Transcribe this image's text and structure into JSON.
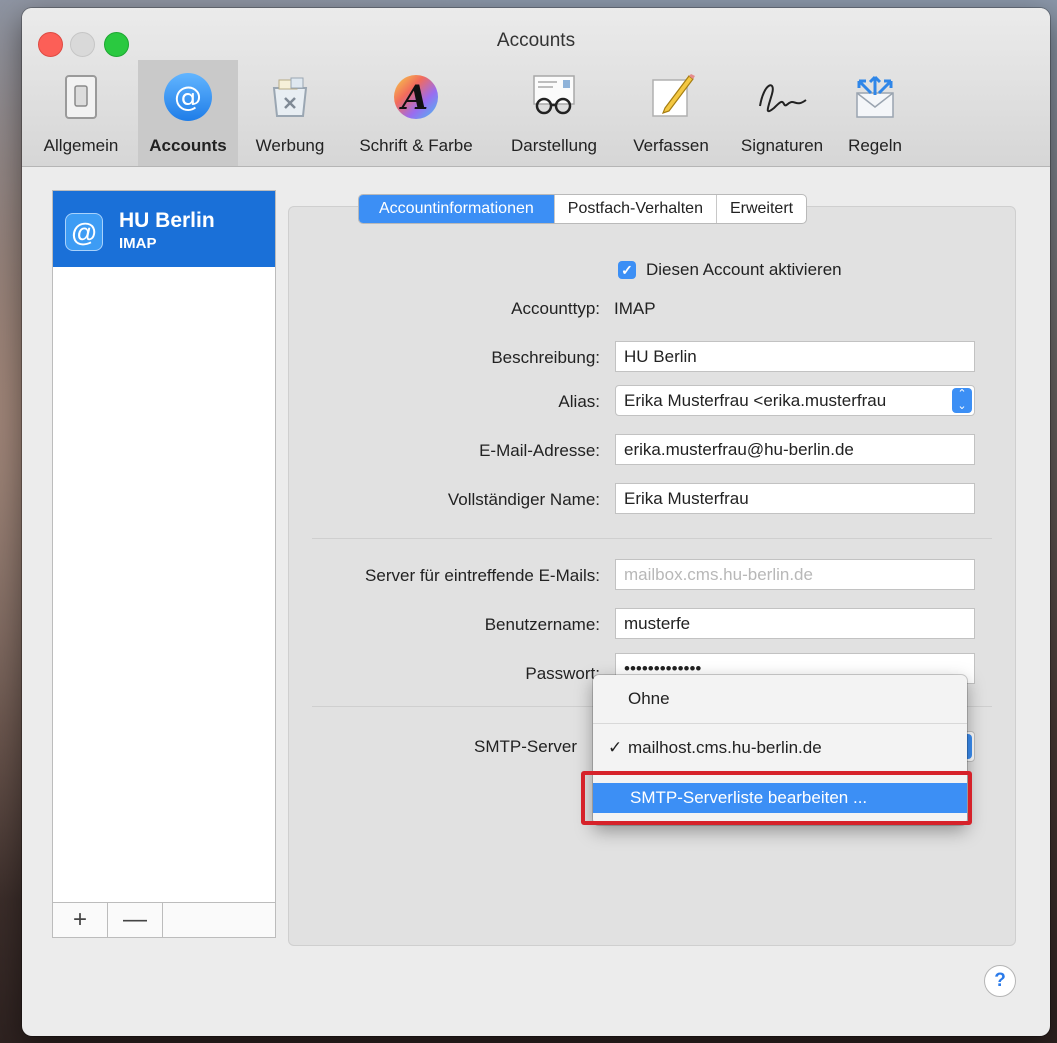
{
  "window": {
    "title": "Accounts"
  },
  "toolbar": {
    "items": [
      {
        "label": "Allgemein",
        "icon": "switch-icon"
      },
      {
        "label": "Accounts",
        "icon": "at-sign-icon"
      },
      {
        "label": "Werbung",
        "icon": "junk-trash-icon"
      },
      {
        "label": "Schrift & Farbe",
        "icon": "font-color-icon"
      },
      {
        "label": "Darstellung",
        "icon": "glasses-icon"
      },
      {
        "label": "Verfassen",
        "icon": "pencil-note-icon"
      },
      {
        "label": "Signaturen",
        "icon": "signature-icon"
      },
      {
        "label": "Regeln",
        "icon": "rules-envelope-icon"
      }
    ],
    "selected": "Accounts"
  },
  "sidebar": {
    "account": {
      "name": "HU Berlin",
      "type": "IMAP",
      "icon_text": "@"
    },
    "add_label": "+",
    "remove_label": "—"
  },
  "tabs": {
    "items": [
      "Accountinformationen",
      "Postfach-Verhalten",
      "Erweitert"
    ],
    "active": "Accountinformationen"
  },
  "form": {
    "enable_label": "Diesen Account aktivieren",
    "enable_checked": true,
    "accounttype_label": "Accounttyp:",
    "accounttype_value": "IMAP",
    "description_label": "Beschreibung:",
    "description_value": "HU Berlin",
    "alias_label": "Alias:",
    "alias_value": "Erika Musterfrau <erika.musterfrau",
    "email_label": "E-Mail-Adresse:",
    "email_value": "erika.musterfrau@hu-berlin.de",
    "fullname_label": "Vollständiger Name:",
    "fullname_value": "Erika Musterfrau",
    "incoming_label": "Server für eintreffende E-Mails:",
    "incoming_value": "mailbox.cms.hu-berlin.de",
    "username_label": "Benutzername:",
    "username_value": "musterfe",
    "password_label": "Passwort:",
    "password_value": "•••••••••••••",
    "smtp_label": "SMTP-Server"
  },
  "smtp_menu": {
    "items": [
      {
        "label": "Ohne",
        "checked": false
      },
      {
        "label": "mailhost.cms.hu-berlin.de",
        "checked": true
      },
      {
        "label": "SMTP-Serverliste bearbeiten ...",
        "highlighted": true
      }
    ],
    "checkmark": "✓"
  },
  "help_label": "?",
  "colors": {
    "accent": "#3c8ff5",
    "highlight_box": "#d6222a",
    "selection": "#1a70d8"
  }
}
